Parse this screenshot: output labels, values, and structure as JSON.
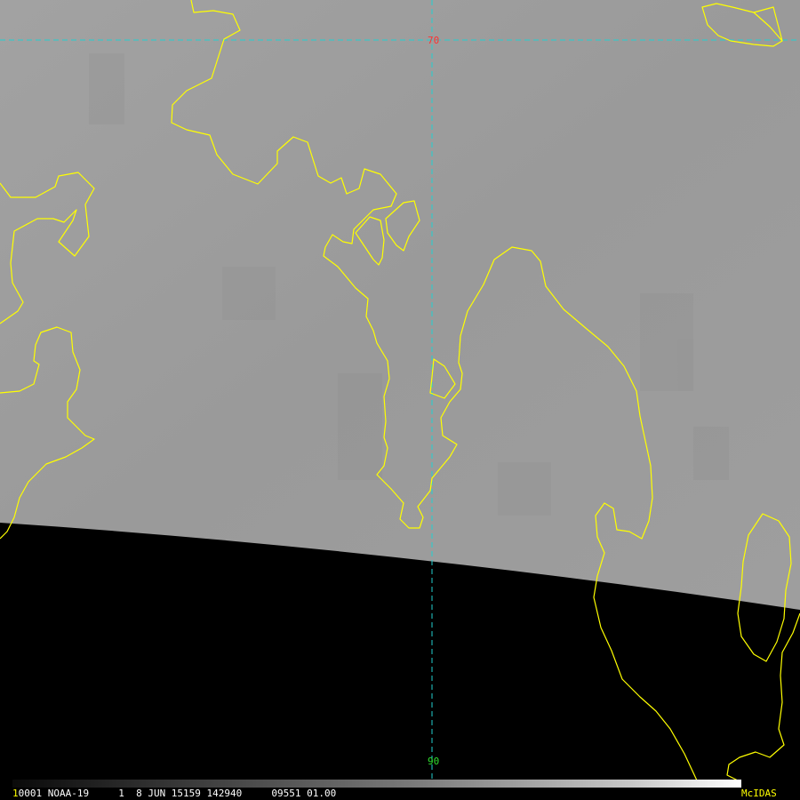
{
  "map": {
    "graticule": {
      "latitude_top": "70",
      "latitude_bottom": "90"
    },
    "colors": {
      "imagery": "#9c9c9c",
      "night": "#000000",
      "coastline": "#ffff00",
      "graticule_line": "#22d0d0",
      "latitude_top_label": "#ff3030",
      "latitude_bottom_label": "#30e030"
    }
  },
  "status_bar": {
    "frame": "1",
    "info": "0001 NOAA-19     1  8 JUN 15159 142940     09551 01.00",
    "logo": "McIDAS"
  }
}
